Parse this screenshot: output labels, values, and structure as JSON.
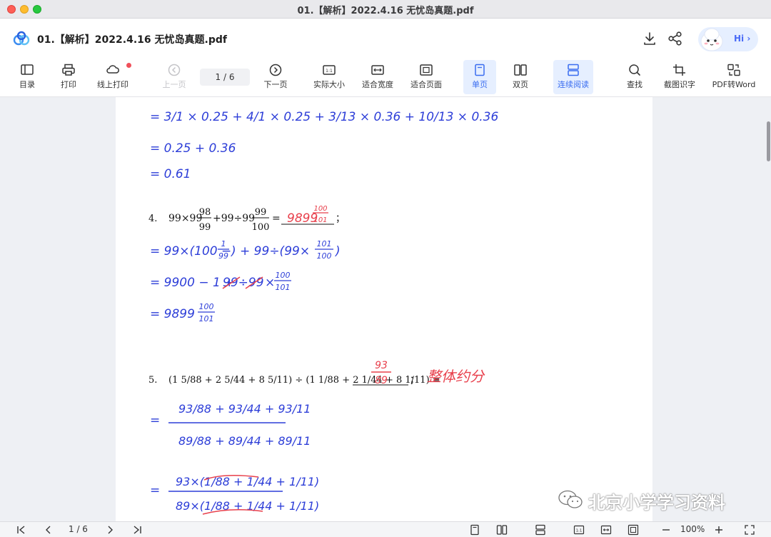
{
  "window": {
    "title": "01.【解析】2022.4.16 无忧岛真题.pdf"
  },
  "header": {
    "doc_title": "01.【解析】2022.4.16 无忧岛真题.pdf",
    "hi_label": "Hi ›"
  },
  "toolbar": {
    "toc": "目录",
    "print": "打印",
    "online_print": "线上打印",
    "prev": "上一页",
    "page_indicator": "1  /  6",
    "next": "下一页",
    "actual_size": "实际大小",
    "fit_width": "适合宽度",
    "fit_page": "适合页面",
    "single_page": "单页",
    "double_page": "双页",
    "continuous": "连续阅读",
    "find": "查找",
    "ocr": "截图识字",
    "pdf_to_word": "PDF转Word"
  },
  "content": {
    "line1": "= 3/1 × 0.25 + 4/1 × 0.25 + 3/13 × 0.36 + 10/13 × 0.36",
    "line2": "= 0.25 + 0.36",
    "line3": "= 0.61",
    "p4_num": "4.",
    "p4_expr_a": "99×99",
    "p4_f1_n": "98",
    "p4_f1_d": "99",
    "p4_expr_b": "+99÷99",
    "p4_f2_n": "99",
    "p4_f2_d": "100",
    "p4_eq": "=",
    "p4_end": "；",
    "p4_ans_int": "9899",
    "p4_ans_n": "100",
    "p4_ans_d": "101",
    "s4_1a": "= 99×(100 −",
    "s4_1_n": "1",
    "s4_1_d": "99",
    "s4_1b": ") + 99÷(99×",
    "s4_1c_n": "101",
    "s4_1c_d": "100",
    "s4_1c": ")",
    "s4_2a": "= 9900 − 1 +",
    "s4_2b": "99÷99",
    "s4_2c": "×",
    "s4_2_n": "100",
    "s4_2_d": "101",
    "s4_3a": "= 9899",
    "s4_3_n": "100",
    "s4_3_d": "101",
    "p5_num": "5.",
    "p5_expr": "(1 5/88 + 2 5/44 + 8 5/11) ÷ (1 1/88 + 2 1/44 + 8 1/11) =",
    "p5_end": "；",
    "p5_ans_n": "93",
    "p5_ans_d": "89",
    "p5_note": "整体约分",
    "s5_eq": "=",
    "s5_top": "93/88 + 93/44 + 93/11",
    "s5_bot": "89/88 + 89/44 + 89/11",
    "s5_top2": "93×(1/88 + 1/44 + 1/11)",
    "s5_bot2": "89×(1/88 + 1/44 + 1/11)"
  },
  "watermark": {
    "text": "北京小学学习资料"
  },
  "statusbar": {
    "page_indicator": "1  /  6",
    "zoom": "100%"
  },
  "colors": {
    "accent": "#3a6df0",
    "ink_blue": "#2d3ed8",
    "ink_red": "#e8404c"
  }
}
